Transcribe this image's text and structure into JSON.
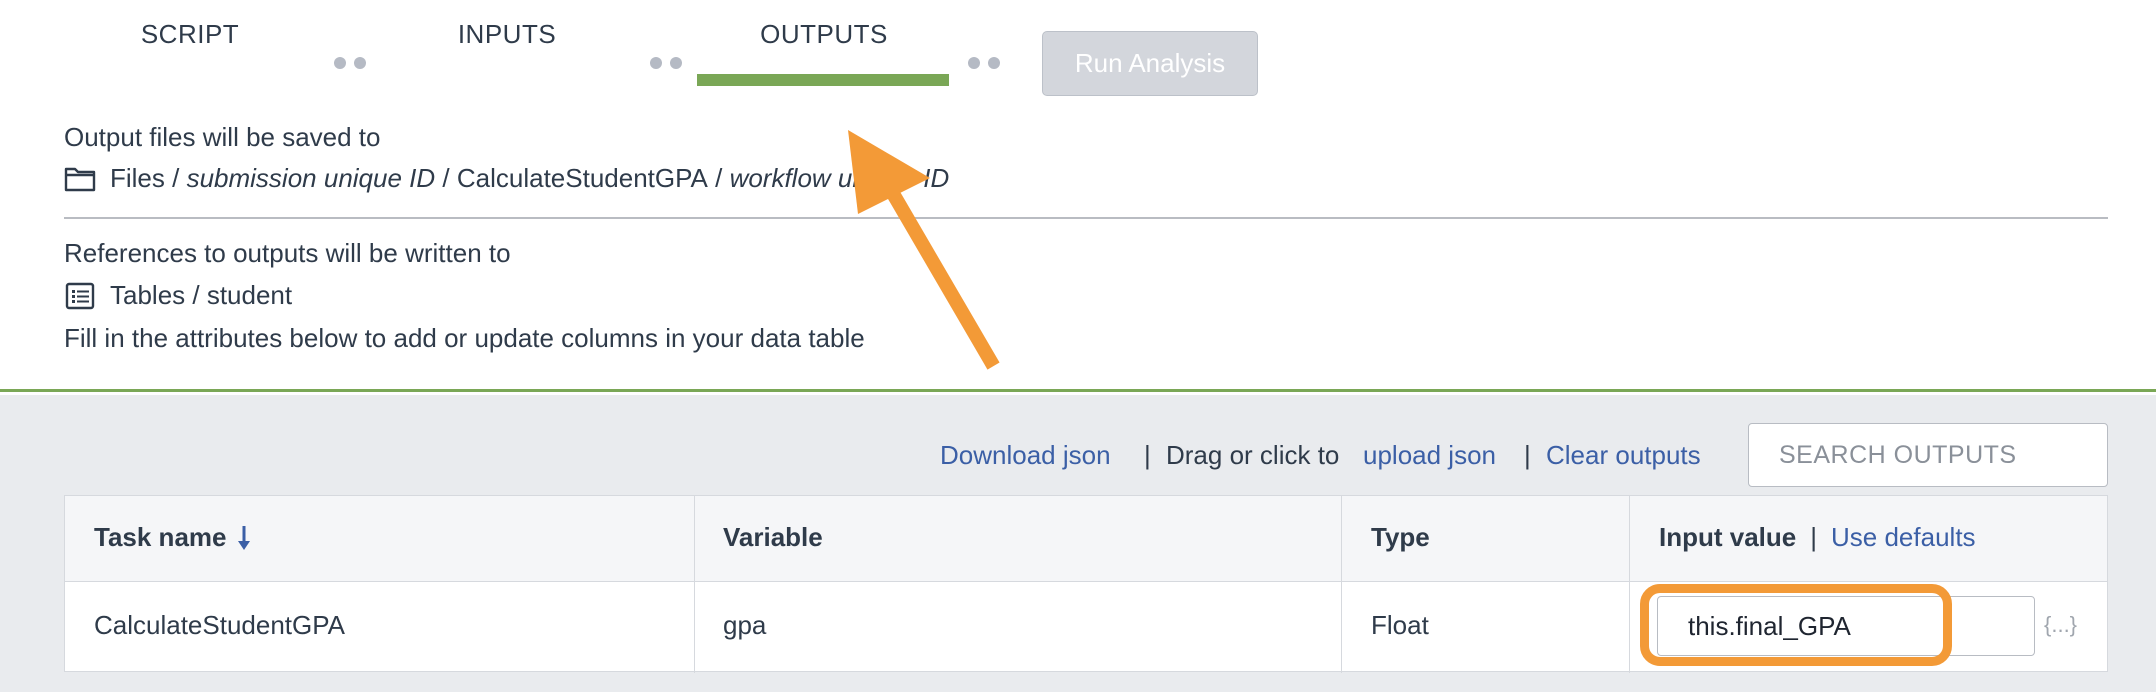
{
  "tabs": [
    {
      "label": "SCRIPT"
    },
    {
      "label": "INPUTS"
    },
    {
      "label": "OUTPUTS",
      "active": true
    }
  ],
  "run_button": {
    "label": "Run Analysis",
    "disabled": true
  },
  "output_info": {
    "heading": "Output files will be saved to",
    "path_prefix": "Files /",
    "path_submission": "submission unique ID",
    "path_sep1": "/",
    "path_workflow_name": "CalculateStudentGPA",
    "path_sep2": "/",
    "path_workflow_id": "workflow unique ID",
    "refs_heading": "References to outputs will be written to",
    "table_path": "Tables / student",
    "instructions": "Fill in the attributes below to add or update columns in your data table"
  },
  "actions": {
    "download": "Download json",
    "sep1": "|",
    "drag_text": "Drag or click to",
    "upload": "upload json",
    "sep2": "|",
    "clear": "Clear outputs"
  },
  "search": {
    "placeholder": "SEARCH OUTPUTS"
  },
  "table": {
    "headers": {
      "task": "Task name",
      "variable": "Variable",
      "type": "Type",
      "input_value": "Input value",
      "sep": "|",
      "use_defaults": "Use defaults"
    },
    "rows": [
      {
        "task": "CalculateStudentGPA",
        "variable": "gpa",
        "type": "Float",
        "value": "this.final_GPA"
      }
    ],
    "braces": "{...}"
  },
  "colors": {
    "accent_green": "#7aa756",
    "link_blue": "#3b5fa6",
    "highlight_orange": "#f39a37"
  },
  "icons": [
    "folder-icon",
    "table-list-icon",
    "sort-down-icon",
    "arrow-annotation"
  ]
}
